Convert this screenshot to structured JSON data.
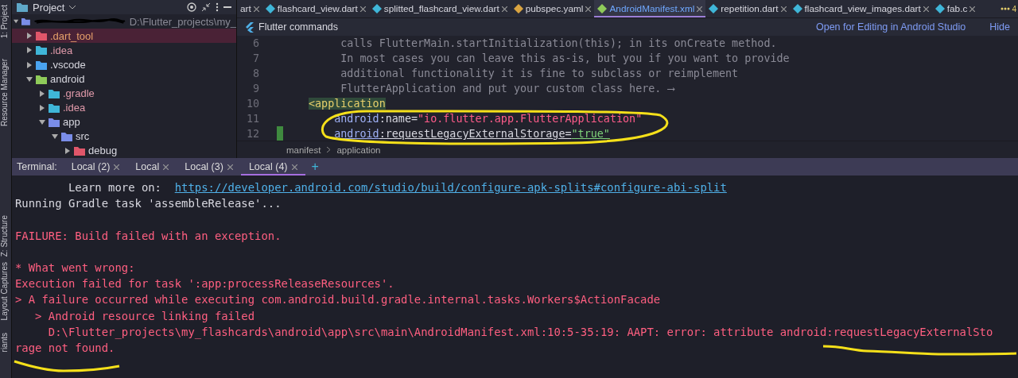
{
  "tool_strip": [
    {
      "label": "1: Project"
    },
    {
      "label": "Resource Manager"
    },
    {
      "label": "Z: Structure"
    },
    {
      "label": "Layout Captures"
    },
    {
      "label": "riants"
    }
  ],
  "project_panel": {
    "title": "Project",
    "root": {
      "path": "D:\\Flutter_projects\\my_",
      "expanded": true,
      "selected": false
    },
    "tree": [
      {
        "label": ".dart_tool",
        "kind": "excluded",
        "expanded": false,
        "selected": true
      },
      {
        "label": ".idea",
        "kind": "idea",
        "expanded": false,
        "selected": false
      },
      {
        "label": ".vscode",
        "kind": "vscode",
        "expanded": false,
        "selected": false
      },
      {
        "label": "android",
        "kind": "android",
        "expanded": true,
        "selected": false,
        "children": [
          {
            "label": ".gradle",
            "kind": "gradle",
            "expanded": false,
            "selected": false
          },
          {
            "label": ".idea",
            "kind": "idea",
            "expanded": false,
            "selected": false
          },
          {
            "label": "app",
            "kind": "module",
            "expanded": true,
            "selected": false,
            "children": [
              {
                "label": "src",
                "kind": "module",
                "expanded": true,
                "selected": false,
                "children": [
                  {
                    "label": "debug",
                    "kind": "excluded",
                    "expanded": false,
                    "selected": false
                  }
                ]
              }
            ]
          }
        ]
      }
    ]
  },
  "editor_tabs": [
    {
      "label": "art",
      "selected": false
    },
    {
      "label": "flashcard_view.dart",
      "kind": "dart",
      "selected": false
    },
    {
      "label": "splitted_flashcard_view.dart",
      "kind": "dart",
      "selected": false
    },
    {
      "label": "pubspec.yaml",
      "kind": "yaml",
      "selected": false
    },
    {
      "label": "AndroidManifest.xml",
      "kind": "android",
      "selected": true
    },
    {
      "label": "repetition.dart",
      "kind": "dart",
      "selected": false
    },
    {
      "label": "flashcard_view_images.dart",
      "kind": "dart",
      "selected": false
    },
    {
      "label": "fab.c",
      "kind": "dart",
      "selected": false
    }
  ],
  "tabs_overflow": "4",
  "flutter_bar": {
    "title": "Flutter commands",
    "action": "Open for Editing in Android Studio",
    "hide": "Hide"
  },
  "code_lines": [
    {
      "number": "6",
      "kind": "comment",
      "changed": false,
      "segments": [
        {
          "kind": "comment",
          "text": "calls FlutterMain.startInitialization(this); in its onCreate method."
        }
      ]
    },
    {
      "number": "7",
      "kind": "comment",
      "changed": false,
      "segments": [
        {
          "kind": "comment",
          "text": "In most cases you can leave this as-is, but you if you want to provide"
        }
      ]
    },
    {
      "number": "8",
      "kind": "comment",
      "changed": false,
      "segments": [
        {
          "kind": "comment",
          "text": "additional functionality it is fine to subclass or reimplement"
        }
      ]
    },
    {
      "number": "9",
      "kind": "comment",
      "changed": false,
      "segments": [
        {
          "kind": "comment",
          "text": "FlutterApplication and put your custom class here. ⟶"
        }
      ]
    },
    {
      "number": "10",
      "kind": "tag",
      "changed": false,
      "segments": [
        {
          "kind": "tag",
          "text": "<application"
        }
      ]
    },
    {
      "number": "11",
      "kind": "attribute",
      "changed": false,
      "segments": [
        {
          "kind": "attr",
          "text": "android"
        },
        {
          "kind": "plain",
          "text": ":name="
        },
        {
          "kind": "string",
          "text": "\"io.flutter.app.FlutterApplication\""
        }
      ]
    },
    {
      "number": "12",
      "kind": "attribute",
      "changed": true,
      "segments": [
        {
          "kind": "attr",
          "text": "android"
        },
        {
          "kind": "plain",
          "text": ":requestLegacyExternalStorage="
        },
        {
          "kind": "value",
          "text": "\"true\""
        }
      ]
    }
  ],
  "breadcrumb": [
    "manifest",
    "application"
  ],
  "terminal": {
    "label": "Terminal:",
    "tabs": [
      {
        "label": "Local (2)",
        "selected": false
      },
      {
        "label": "Local",
        "selected": false
      },
      {
        "label": "Local (3)",
        "selected": false
      },
      {
        "label": "Local (4)",
        "selected": true
      }
    ],
    "add": "+",
    "lines": [
      {
        "kind": "link",
        "text": "        Learn more on:  ",
        "link": "https://developer.android.com/studio/build/configure-apk-splits#configure-abi-split"
      },
      {
        "kind": "info",
        "text": "Running Gradle task 'assembleRelease'..."
      },
      {
        "kind": "blank"
      },
      {
        "kind": "error",
        "text": "FAILURE: Build failed with an exception."
      },
      {
        "kind": "blank"
      },
      {
        "kind": "error",
        "text": "* What went wrong:"
      },
      {
        "kind": "error",
        "text": "Execution failed for task ':app:processReleaseResources'."
      },
      {
        "kind": "error",
        "text": "> A failure occurred while executing com.android.build.gradle.internal.tasks.Workers$ActionFacade"
      },
      {
        "kind": "error",
        "text": "   > Android resource linking failed"
      },
      {
        "kind": "error",
        "text": "     D:\\Flutter_projects\\my_flashcards\\android\\app\\src\\main\\AndroidManifest.xml:10:5-35:19: AAPT: error: attribute android:requestLegacyExternalSto"
      },
      {
        "kind": "error",
        "text": "rage not found."
      }
    ]
  }
}
